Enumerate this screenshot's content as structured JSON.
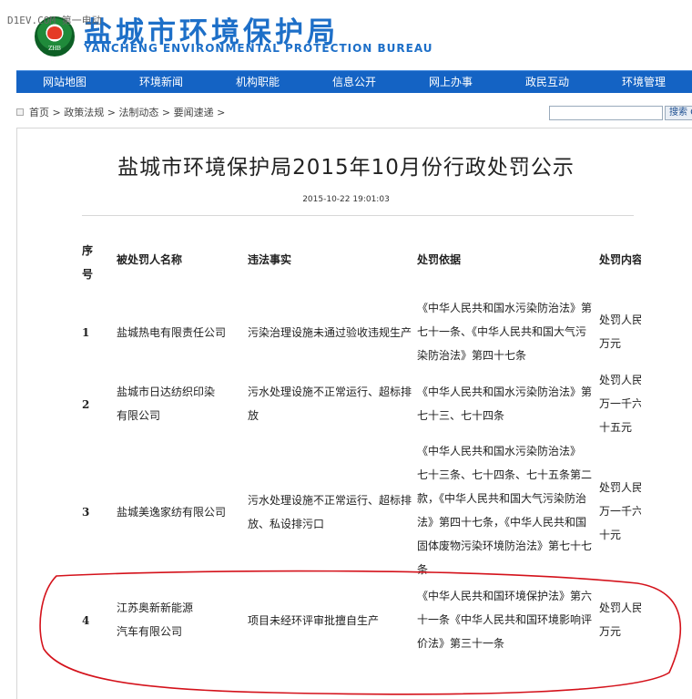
{
  "watermark": "D1EV.COM 第一电动",
  "header": {
    "title": "盐城市环境保护局",
    "subtitle": "YANCHENG ENVIRONMENTAL PROTECTION BUREAU",
    "logo_text": "ZHB"
  },
  "nav": {
    "items": [
      {
        "label": "网站地图"
      },
      {
        "label": "环境新闻"
      },
      {
        "label": "机构职能"
      },
      {
        "label": "信息公开"
      },
      {
        "label": "网上办事"
      },
      {
        "label": "政民互动"
      },
      {
        "label": "环境管理"
      }
    ]
  },
  "breadcrumb": {
    "items": [
      "首页",
      "政策法规",
      "法制动态",
      "要闻速递"
    ],
    "separator": " > "
  },
  "search": {
    "placeholder": "",
    "button_label": "搜索 C"
  },
  "article": {
    "title": "盐城市环境保护局2015年10月份行政处罚公示",
    "date": "2015-10-22 19:01:03"
  },
  "table": {
    "headers": {
      "seq_line1": "序",
      "seq_line2": "号",
      "name": "被处罚人名称",
      "fact": "违法事实",
      "basis": "处罚依据",
      "penalty": "处罚内容"
    },
    "rows": [
      {
        "seq": "1",
        "name": [
          "盐城热电有限责任公司"
        ],
        "fact": [
          "污染治理设施未通过验收违规生产"
        ],
        "basis": [
          "《中华人民共和国水污染防治法》第",
          "七十一条、《中华人民共和国大气污",
          "染防治法》第四十七条"
        ],
        "penalty": [
          "处罚人民",
          "万元"
        ]
      },
      {
        "seq": "2",
        "name": [
          "盐城市日达纺织印染",
          "有限公司"
        ],
        "fact": [
          "污水处理设施不正常运行、超标排",
          "放"
        ],
        "basis": [
          "《中华人民共和国水污染防治法》第",
          "七十三、七十四条"
        ],
        "penalty": [
          "处罚人民",
          "万一千六",
          "十五元"
        ]
      },
      {
        "seq": "3",
        "name": [
          "盐城美逸家纺有限公司"
        ],
        "fact": [
          "污水处理设施不正常运行、超标排",
          "放、私设排污口"
        ],
        "basis": [
          "《中华人民共和国水污染防治法》",
          "七十三条、七十四条、七十五条第二",
          "款，《中华人民共和国大气污染防治",
          "法》第四十七条，《中华人民共和国",
          "固体废物污染环境防治法》第七十七",
          "条"
        ],
        "penalty": [
          "处罚人民",
          "万一千六",
          "十元"
        ]
      },
      {
        "seq": "4",
        "name": [
          "江苏奥新新能源",
          "汽车有限公司"
        ],
        "fact": [
          "项目未经环评审批擅自生产"
        ],
        "basis": [
          "《中华人民共和国环境保护法》第六",
          "十一条《中华人民共和国环境影响评",
          "价法》第三十一条"
        ],
        "penalty": [
          "处罚人民",
          "万元"
        ]
      }
    ]
  },
  "colors": {
    "brand_blue": "#1d6fc8",
    "nav_blue": "#1463c4",
    "highlight_red": "#d4121b"
  }
}
